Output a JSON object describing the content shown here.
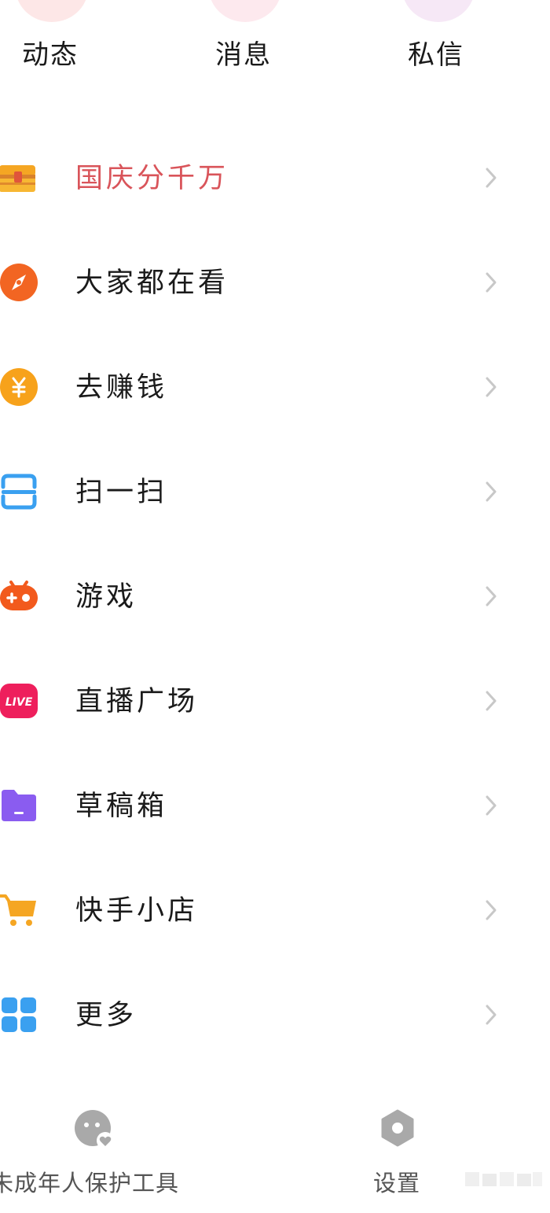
{
  "top_tabs": [
    {
      "label": "动态",
      "icon": "dynamic-icon"
    },
    {
      "label": "消息",
      "icon": "message-icon"
    },
    {
      "label": "私信",
      "icon": "private-message-icon"
    }
  ],
  "menu": [
    {
      "label": "国庆分千万",
      "icon": "treasure-chest-icon",
      "highlight": true
    },
    {
      "label": "大家都在看",
      "icon": "compass-icon"
    },
    {
      "label": "去赚钱",
      "icon": "yuan-coin-icon"
    },
    {
      "label": "扫一扫",
      "icon": "scan-icon"
    },
    {
      "label": "游戏",
      "icon": "gamepad-icon"
    },
    {
      "label": "直播广场",
      "icon": "live-icon",
      "badge": "LIVE"
    },
    {
      "label": "草稿箱",
      "icon": "drafts-folder-icon"
    },
    {
      "label": "快手小店",
      "icon": "shopping-cart-icon"
    },
    {
      "label": "更多",
      "icon": "grid-more-icon"
    }
  ],
  "bottom": {
    "minor_protection_label": "未成年人保护工具",
    "settings_label": "设置"
  },
  "colors": {
    "highlight": "#d9545a",
    "chevron": "#c8c8c8",
    "compass": "#f26522",
    "coin": "#f7a21b",
    "scan": "#3aa0f0",
    "game": "#f25a1d",
    "live": "#ee1f5c",
    "folder": "#8a5cf0",
    "cart": "#f5a623",
    "grid": "#3aa0f0",
    "bottom_icon": "#a9a9a9"
  }
}
